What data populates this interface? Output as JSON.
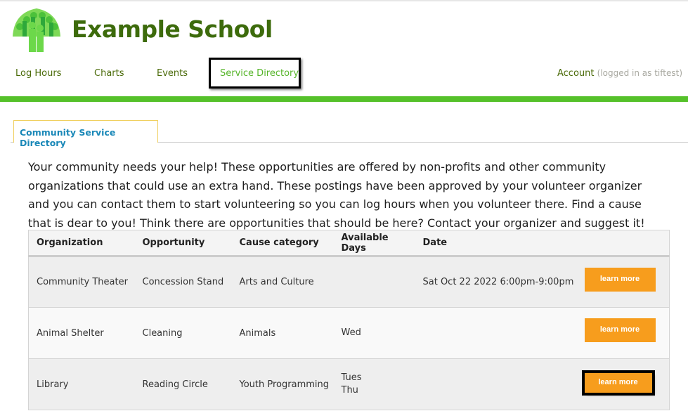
{
  "header": {
    "logo_icon": "tree-of-people-logo",
    "site_title": "Example School"
  },
  "nav": {
    "items": [
      {
        "label": "Log Hours",
        "active": false
      },
      {
        "label": "Charts",
        "active": false
      },
      {
        "label": "Events",
        "active": false
      },
      {
        "label": "Service Directory",
        "active": true
      }
    ],
    "account_label": "Account",
    "logged_in_text": "(logged in as tiftest)"
  },
  "tabs": [
    {
      "label": "Community Service Directory",
      "active": true
    }
  ],
  "intro_text": "Your community needs your help! These opportunities are offered by non-profits and other community organizations that could use an extra hand. These postings have been approved by your volunteer organizer and you can contact them to start volunteering so you can log hours when you volunteer there. Find a cause that is dear to you! Think there are opportunities that should be here? Contact your organizer and suggest it!",
  "table": {
    "headers": [
      "Organization",
      "Opportunity",
      "Cause category",
      "Available Days",
      "Date",
      ""
    ],
    "rows": [
      {
        "organization": "Community Theater",
        "opportunity": "Concession Stand",
        "cause": "Arts and Culture",
        "days": [
          "",
          ""
        ],
        "date": "Sat Oct 22 2022 6:00pm-9:00pm",
        "button": "learn more"
      },
      {
        "organization": "Animal Shelter",
        "opportunity": "Cleaning",
        "cause": "Animals",
        "days": [
          "Wed",
          ""
        ],
        "date": "",
        "button": "learn more"
      },
      {
        "organization": "Library",
        "opportunity": "Reading Circle",
        "cause": "Youth Programming",
        "days": [
          "Tues",
          "Thu"
        ],
        "date": "",
        "button": "learn more"
      }
    ]
  },
  "colors": {
    "brand_green": "#55c12a",
    "title_green": "#3d6b0c",
    "tab_blue": "#1a88b8",
    "button_orange": "#f79d1d"
  }
}
